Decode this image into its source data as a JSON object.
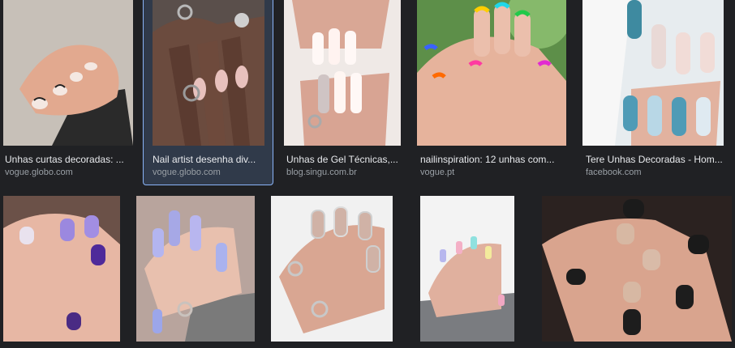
{
  "results": [
    {
      "caption": "Unhas curtas decoradas: ...",
      "source": "vogue.globo.com",
      "selected": false,
      "image_subject": "short-nails-photo"
    },
    {
      "caption": "Nail artist desenha div...",
      "source": "vogue.globo.com",
      "selected": true,
      "image_subject": "decorated-nails-photo"
    },
    {
      "caption": "Unhas de Gel Técnicas,...",
      "source": "blog.singu.com.br",
      "selected": false,
      "image_subject": "gel-nails-photo"
    },
    {
      "caption": "nailinspiration: 12 unhas com...",
      "source": "vogue.pt",
      "selected": false,
      "image_subject": "rainbow-french-nails-photo"
    },
    {
      "caption": "Tere Unhas Decoradas - Hom...",
      "source": "facebook.com",
      "selected": false,
      "image_subject": "glitter-nails-photo"
    },
    {
      "image_subject": "purple-nails-photo"
    },
    {
      "image_subject": "lavender-nails-photo"
    },
    {
      "image_subject": "chrome-french-nails-photo"
    },
    {
      "image_subject": "pastel-nails-photo"
    },
    {
      "image_subject": "black-nude-nails-photo"
    }
  ],
  "colors": {
    "background": "#202124",
    "selected_border": "#8ab4f8",
    "caption_text": "#e8eaed",
    "source_text": "#9aa0a6"
  }
}
